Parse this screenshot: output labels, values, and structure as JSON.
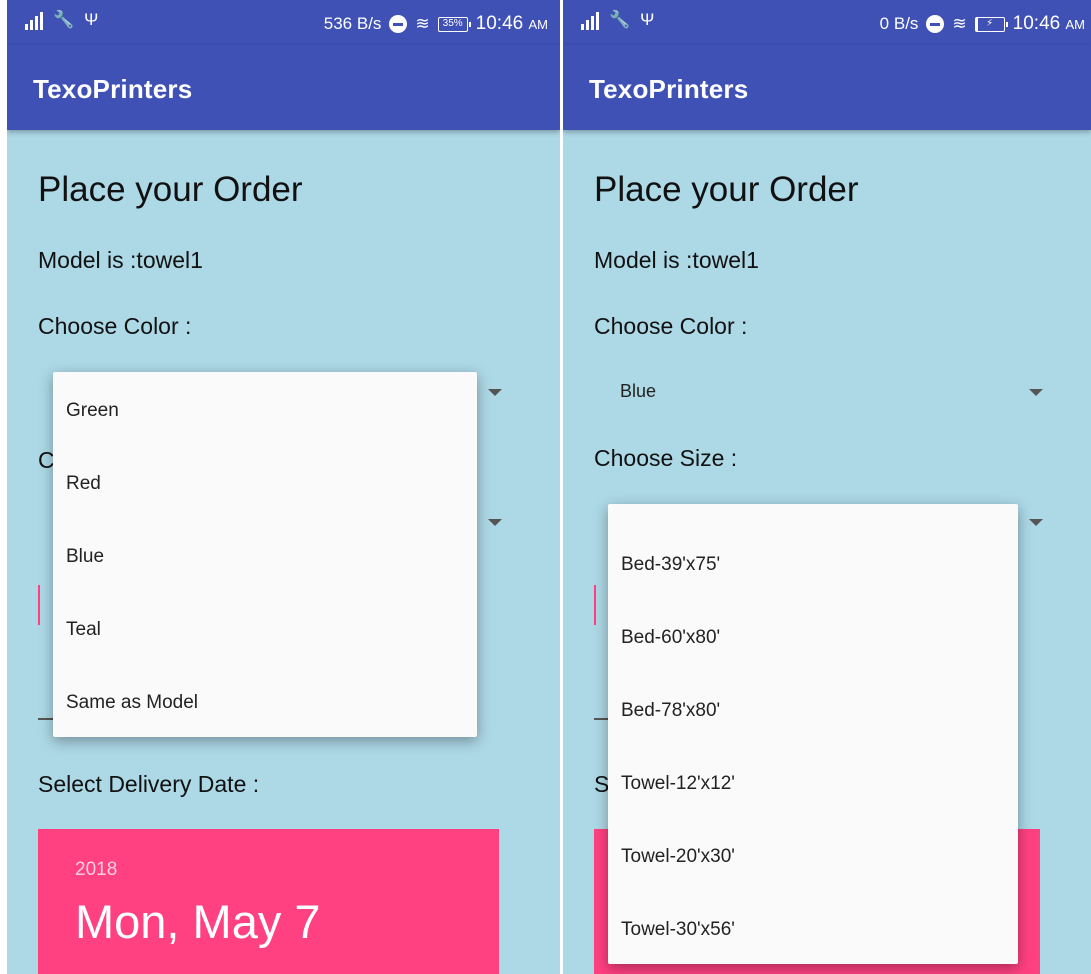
{
  "left_screen": {
    "status": {
      "speed": "536 B/s",
      "battery": "35%",
      "time": "10:46",
      "ampm": "AM"
    },
    "app_title": "TexoPrinters",
    "heading": "Place your Order",
    "model_line": "Model is :towel1",
    "choose_color": "Choose Color :",
    "color_options": [
      "Green",
      "Red",
      "Blue",
      "Teal",
      "Same as Model"
    ],
    "delivery_label": "Select Delivery Date :",
    "date_year": "2018",
    "date_big": "Mon, May 7"
  },
  "right_screen": {
    "status": {
      "speed": "0 B/s",
      "time": "10:46",
      "ampm": "AM"
    },
    "app_title": "TexoPrinters",
    "heading": "Place your Order",
    "model_line": "Model is :towel1",
    "choose_color": "Choose Color :",
    "selected_color": "Blue",
    "choose_size": "Choose Size :",
    "size_options": [
      "Bed-39'x75'",
      "Bed-60'x80'",
      "Bed-78'x80'",
      "Towel-12'x12'",
      "Towel-20'x30'",
      "Towel-30'x56'"
    ]
  },
  "colors": {
    "primary": "#3f51b5",
    "background": "#add8e6",
    "accent": "#ff4081"
  }
}
